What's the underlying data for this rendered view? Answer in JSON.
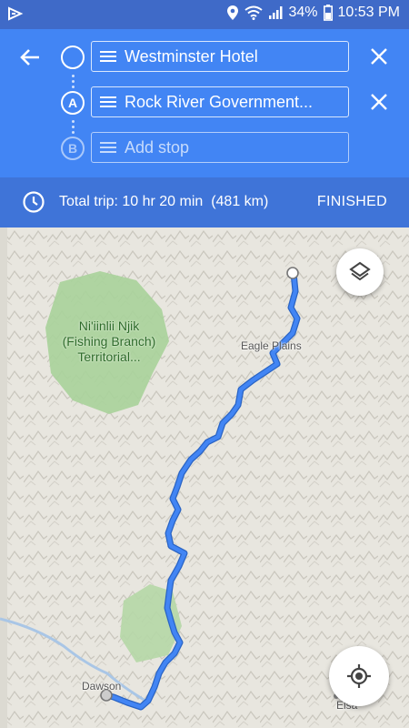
{
  "status_bar": {
    "battery": "34%",
    "time": "10:53 PM"
  },
  "route": {
    "origin": "Westminster Hotel",
    "waypoint_marker": "A",
    "waypoint": "Rock River Government...",
    "stop_marker": "B",
    "add_stop_placeholder": "Add stop"
  },
  "trip": {
    "summary": "Total trip: 10 hr 20 min  (481 km)",
    "finished_label": "FINISHED"
  },
  "map": {
    "park_label": "Ni'iinlii Njik (Fishing Branch) Territorial...",
    "places": [
      "Eagle Plains",
      "Dawson",
      "Elsa"
    ]
  },
  "colors": {
    "header": "#4285f4",
    "status_bar": "#3f6ac8",
    "trip_bar": "#3f74d8",
    "route_line": "#4285f4",
    "park": "#a9d19a"
  },
  "icons": [
    "back-arrow-icon",
    "menu-icon",
    "close-icon",
    "clock-icon",
    "layers-icon",
    "my-location-icon"
  ]
}
